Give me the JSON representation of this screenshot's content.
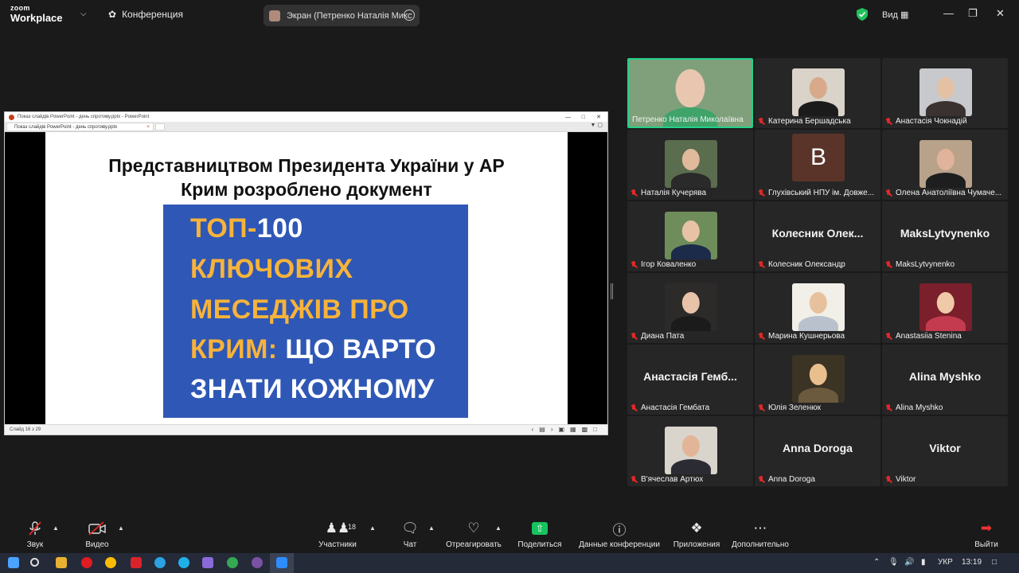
{
  "app": {
    "logo_small": "zoom",
    "logo_main": "Workplace",
    "meeting_label": "Конференция",
    "share_title": "Экран (Петренко Наталія Микс",
    "view_label": "Вид"
  },
  "presentation": {
    "window_title": "Показ слайдів PowerPoint - день спротиву.pptx - PowerPoint",
    "tab_label": "Показ слайдів PowerPoint - день спротиву.pptx",
    "slide_heading": "Представництвом Президента України у АР Крим розроблено документ",
    "book": {
      "line1_a": "ТОП-",
      "line1_b": "100",
      "line2": "КЛЮЧОВИХ",
      "line3": "МЕСЕДЖІВ ПРО",
      "line4_a": "КРИМ:",
      "line4_b": " ЩО ВАРТО",
      "line5": "ЗНАТИ КОЖНОМУ"
    },
    "status": "Слайд 16 з 29"
  },
  "participants": [
    {
      "name": "Петренко Наталія Миколаївна",
      "video": true,
      "muted": false,
      "active": true
    },
    {
      "name": "Катерина Бершадська",
      "video": true,
      "muted": true
    },
    {
      "name": "Анастасія Чокнадій",
      "video": true,
      "muted": true
    },
    {
      "name": "Наталія Кучерява",
      "video": true,
      "muted": true
    },
    {
      "name": "Глухівський НПУ ім. Довже...",
      "avatar_letter": "B",
      "muted": true
    },
    {
      "name": "Олена Анатоліївна Чумаче...",
      "video": true,
      "muted": true
    },
    {
      "name": "Ігор Коваленко",
      "video": true,
      "muted": true
    },
    {
      "name": "Колесник Олександр",
      "display_name": "Колесник Олек...",
      "muted": true
    },
    {
      "name": "MaksLytvynenko",
      "display_name": "MaksLytvynenko",
      "muted": true
    },
    {
      "name": "Диана Пата",
      "video": true,
      "muted": true
    },
    {
      "name": "Марина Кушнерьова",
      "video": true,
      "muted": true
    },
    {
      "name": "Anastasiia Stenina",
      "video": true,
      "muted": true
    },
    {
      "name": "Анастасія Гембата",
      "display_name": "Анастасія Гемб...",
      "muted": true
    },
    {
      "name": "Юлія Зеленюк",
      "video": true,
      "muted": true
    },
    {
      "name": "Alina Myshko",
      "display_name": "Alina Myshko",
      "muted": true
    },
    {
      "name": "В'ячеслав Артюх",
      "video": true,
      "muted": true
    },
    {
      "name": "Anna Doroga",
      "display_name": "Anna Doroga",
      "muted": true
    },
    {
      "name": "Viktor",
      "display_name": "Viktor",
      "muted": true
    }
  ],
  "toolbar": {
    "audio": "Звук",
    "video": "Видео",
    "participants": "Участники",
    "participants_count": "18",
    "chat": "Чат",
    "react": "Отреагировать",
    "share": "Поделиться",
    "meeting_info": "Данные конференции",
    "apps": "Приложения",
    "more": "Дополнительно",
    "leave": "Выйти"
  },
  "taskbar": {
    "lang": "УКР",
    "time": "13:19"
  }
}
